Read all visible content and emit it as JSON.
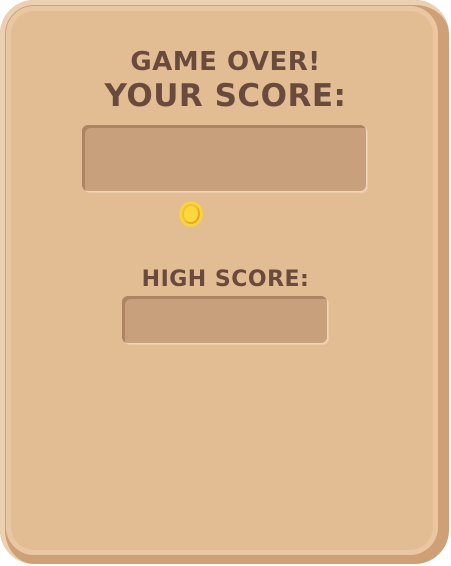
{
  "game_over": {
    "title": "GAME OVER!",
    "score_label": "YOUR SCORE:",
    "score_value": "",
    "high_score_label": "HIGH SCORE:",
    "high_score_value": ""
  },
  "colors": {
    "panel": "#e2bd93",
    "panel_edge": "#cf9f76",
    "slot": "#c9a07c",
    "text": "#6a4a3d",
    "coin": "#f3c22c"
  },
  "icons": {
    "coin": "coin-icon"
  }
}
